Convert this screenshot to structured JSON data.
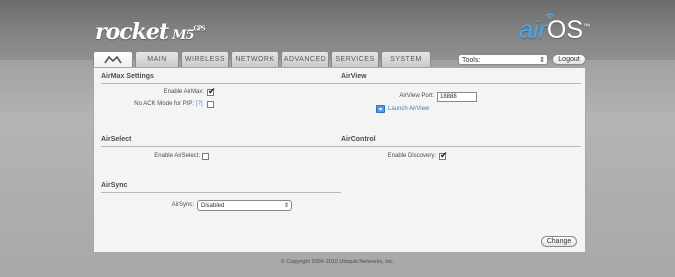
{
  "header": {
    "brand": "rocket",
    "brand_model": "M5",
    "brand_suffix": "GPS",
    "os_prefix": "air",
    "os_name": "OS",
    "os_tm": "™"
  },
  "tabs": [
    {
      "label": "",
      "icon": "ubiquiti-logo-icon",
      "active": true
    },
    {
      "label": "MAIN"
    },
    {
      "label": "WIRELESS"
    },
    {
      "label": "NETWORK"
    },
    {
      "label": "ADVANCED"
    },
    {
      "label": "SERVICES"
    },
    {
      "label": "SYSTEM"
    }
  ],
  "toolbar": {
    "tools_value": "Tools:",
    "logout_label": "Logout"
  },
  "airmax": {
    "title": "AirMax Settings",
    "enable_label": "Enable AirMax:",
    "enable_checked": true,
    "noack_label": "No ACK Mode for PtP:",
    "noack_help": "[?]",
    "noack_checked": false
  },
  "airview": {
    "title": "AirView",
    "port_label": "AirView Port:",
    "port_value": "18888",
    "launch_label": "Launch AirView"
  },
  "airselect": {
    "title": "AirSelect",
    "enable_label": "Enable AirSelect:",
    "enable_checked": false
  },
  "aircontrol": {
    "title": "AirControl",
    "discovery_label": "Enable Discovery:",
    "discovery_checked": true
  },
  "airsync": {
    "title": "AirSync",
    "label": "AirSync:",
    "value": "Disabled"
  },
  "actions": {
    "change_label": "Change"
  },
  "footer": {
    "copyright": "© Copyright 2006-2010 Ubiquiti Networks, Inc."
  },
  "colors": {
    "accent_blue": "#4ea6ea",
    "panel_bg": "#f4f4f4",
    "text_dark": "#4d4d4d"
  }
}
